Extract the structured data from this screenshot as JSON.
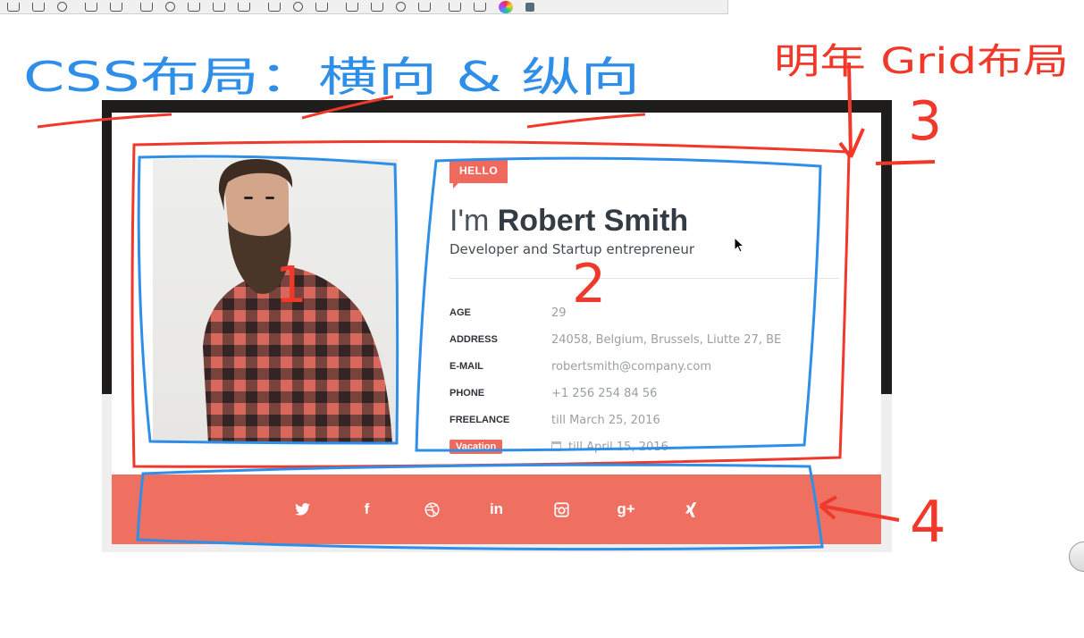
{
  "card": {
    "hello_badge": "HELLO",
    "greeting": "I'm",
    "name": "Robert Smith",
    "role": "Developer and Startup entrepreneur",
    "details": [
      {
        "label": "AGE",
        "value": "29"
      },
      {
        "label": "ADDRESS",
        "value": "24058, Belgium, Brussels, Liutte 27, BE"
      },
      {
        "label": "E-MAIL",
        "value": "robertsmith@company.com"
      },
      {
        "label": "PHONE",
        "value": "+1 256 254 84 56"
      },
      {
        "label": "FREELANCE",
        "value": "till March 25, 2016"
      }
    ],
    "vacation": {
      "label": "Vacation",
      "value": "till April 15, 2016"
    },
    "social": [
      {
        "icon": "twitter-icon",
        "glyph": ""
      },
      {
        "icon": "facebook-icon",
        "glyph": "f"
      },
      {
        "icon": "dribbble-icon",
        "glyph": ""
      },
      {
        "icon": "linkedin-icon",
        "glyph": "in"
      },
      {
        "icon": "instagram-icon",
        "glyph": ""
      },
      {
        "icon": "google-plus-icon",
        "glyph": "g+"
      },
      {
        "icon": "xing-icon",
        "glyph": ""
      }
    ]
  },
  "annotations": {
    "css_layout_note": "CSS布局：横向 & 纵向",
    "grid_note": "明年 Grid布局",
    "n1": "1",
    "n2": "2",
    "n3": "3",
    "n4": "4"
  },
  "colors": {
    "accent": "#ef6a5d",
    "annotation_blue": "#2f8fe8",
    "annotation_red": "#f0392a"
  }
}
